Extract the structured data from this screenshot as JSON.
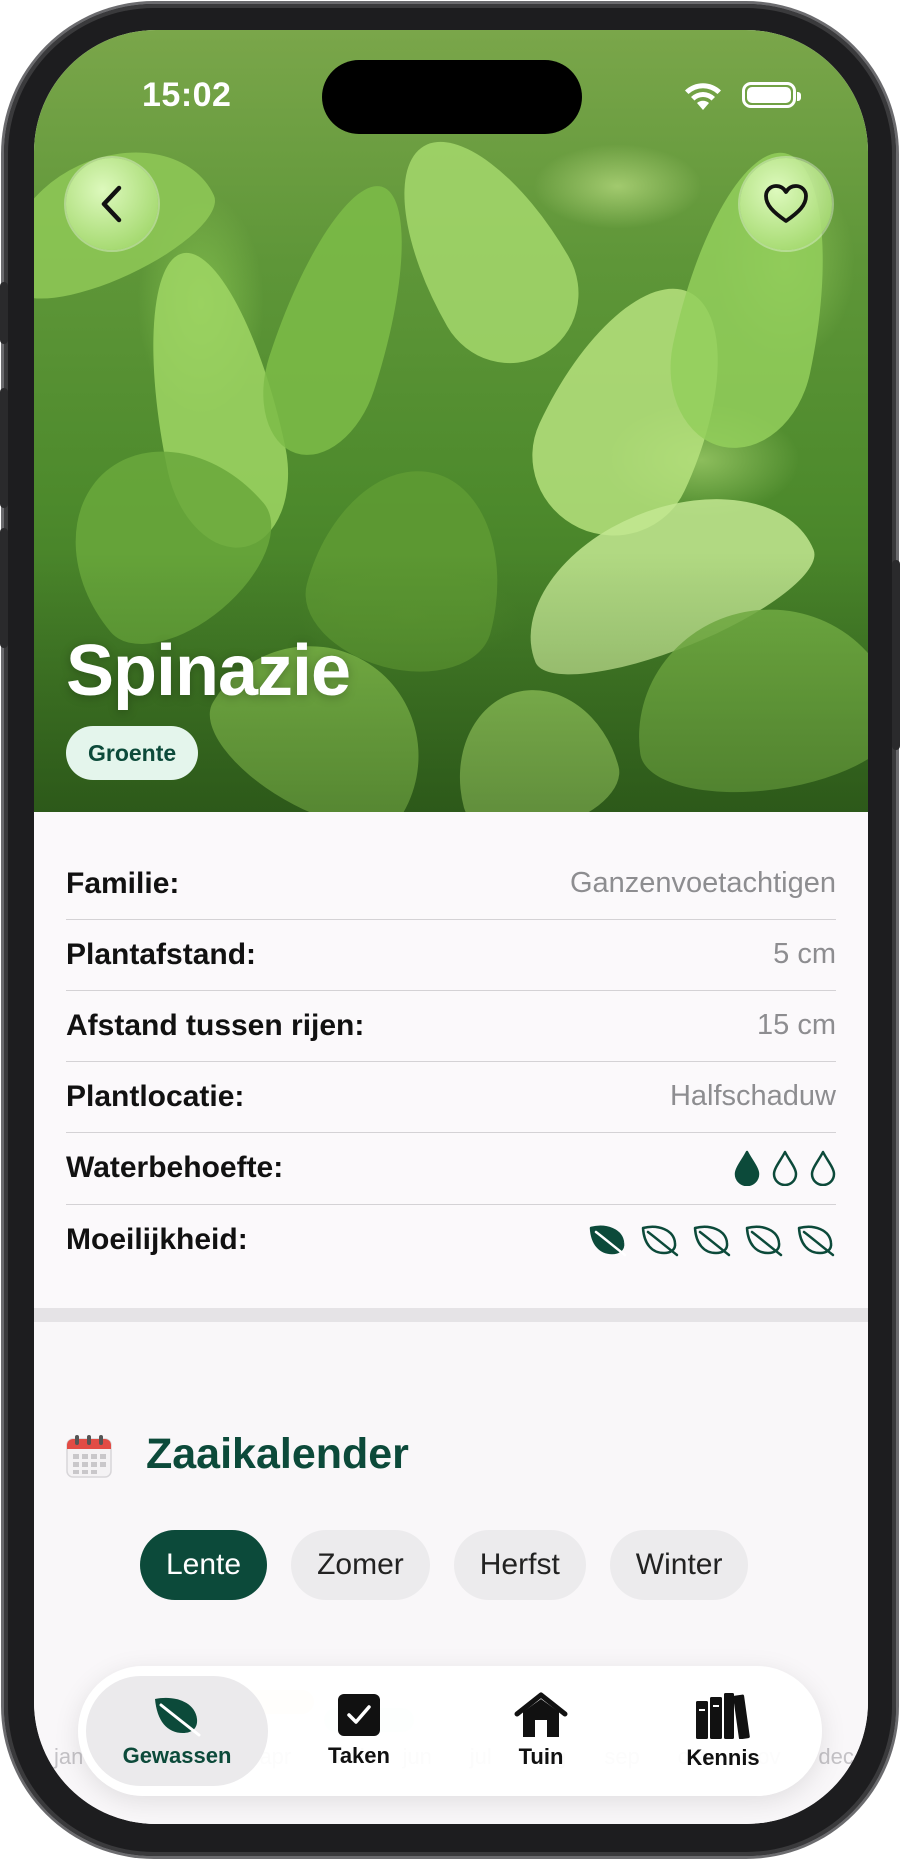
{
  "status_bar": {
    "time": "15:02"
  },
  "hero": {
    "title": "Spinazie",
    "category": "Groente"
  },
  "details": [
    {
      "label": "Familie:",
      "value": "Ganzenvoetachtigen"
    },
    {
      "label": "Plantafstand:",
      "value": "5 cm"
    },
    {
      "label": "Afstand tussen rijen:",
      "value": "15 cm"
    },
    {
      "label": "Plantlocatie:",
      "value": "Halfschaduw"
    },
    {
      "label": "Waterbehoefte:",
      "level": 1,
      "max": 3,
      "icon": "water-drop-icon"
    },
    {
      "label": "Moeilijkheid:",
      "level": 1,
      "max": 5,
      "icon": "leaf-icon"
    }
  ],
  "calendar": {
    "title": "Zaaikalender",
    "seasons": [
      "Lente",
      "Zomer",
      "Herfst",
      "Winter"
    ],
    "selected_season": "Lente",
    "months": [
      "jan",
      "feb",
      "mrt",
      "apr",
      "mei",
      "jun",
      "jul",
      "aug",
      "sep",
      "okt",
      "nov",
      "dec"
    ]
  },
  "tabbar": {
    "tabs": [
      {
        "label": "Gewassen",
        "icon": "leaf-icon",
        "active": true
      },
      {
        "label": "Taken",
        "icon": "checkbox-icon",
        "active": false
      },
      {
        "label": "Tuin",
        "icon": "house-icon",
        "active": false
      },
      {
        "label": "Kennis",
        "icon": "books-icon",
        "active": false
      }
    ]
  },
  "colors": {
    "brand": "#0c4a3a",
    "chip_bg": "#e4f5ec",
    "muted_text": "#8d8d90"
  }
}
